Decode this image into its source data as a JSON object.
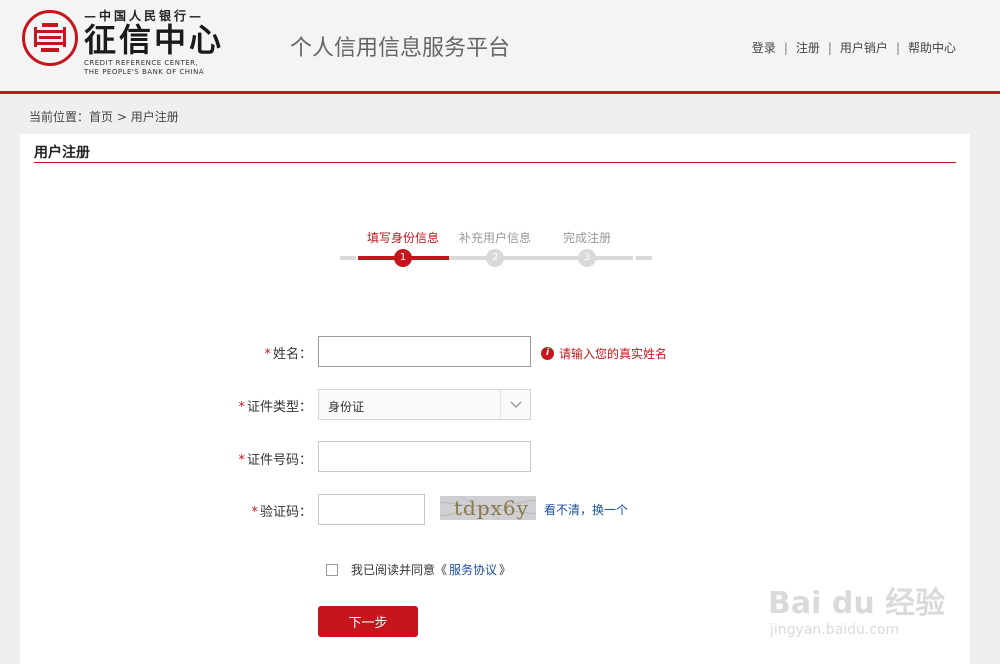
{
  "header": {
    "logo_top": "—中国人民银行—",
    "logo_main": "征信中心",
    "logo_en_line1": "CREDIT REFERENCE CENTER,",
    "logo_en_line2": "THE PEOPLE'S BANK OF CHINA",
    "platform_title": "个人信用信息服务平台",
    "nav": [
      {
        "label": "登录"
      },
      {
        "label": "注册"
      },
      {
        "label": "用户销户"
      },
      {
        "label": "帮助中心"
      }
    ],
    "nav_separator": "|"
  },
  "breadcrumb": {
    "prefix": "当前位置：",
    "home": "首页",
    "separator": " > ",
    "current": "用户注册"
  },
  "panel": {
    "title": "用户注册"
  },
  "steps": [
    {
      "label": "填写身份信息",
      "number": "1",
      "active": true
    },
    {
      "label": "补充用户信息",
      "number": "2",
      "active": false
    },
    {
      "label": "完成注册",
      "number": "3",
      "active": false
    }
  ],
  "form": {
    "required_mark": "*",
    "name_label": "姓名：",
    "name_value": "",
    "name_hint": "请输入您的真实姓名",
    "name_hint_icon": "i",
    "id_type_label": "证件类型：",
    "id_type_value": "身份证",
    "id_number_label": "证件号码：",
    "id_number_value": "",
    "captcha_label": "验证码：",
    "captcha_value": "",
    "captcha_image_text": "tdpx6y",
    "captcha_refresh": "看不清，换一个",
    "agree_prefix": "我已阅读并同意《",
    "agree_link": "服务协议",
    "agree_suffix": "》",
    "next_button": "下一步"
  },
  "watermark": {
    "main": "Bai du 经验",
    "sub": "jingyan.baidu.com"
  },
  "colors": {
    "brand_red": "#c4161c",
    "link_blue": "#1a4e9e",
    "step_inactive": "#d9d9d9"
  }
}
